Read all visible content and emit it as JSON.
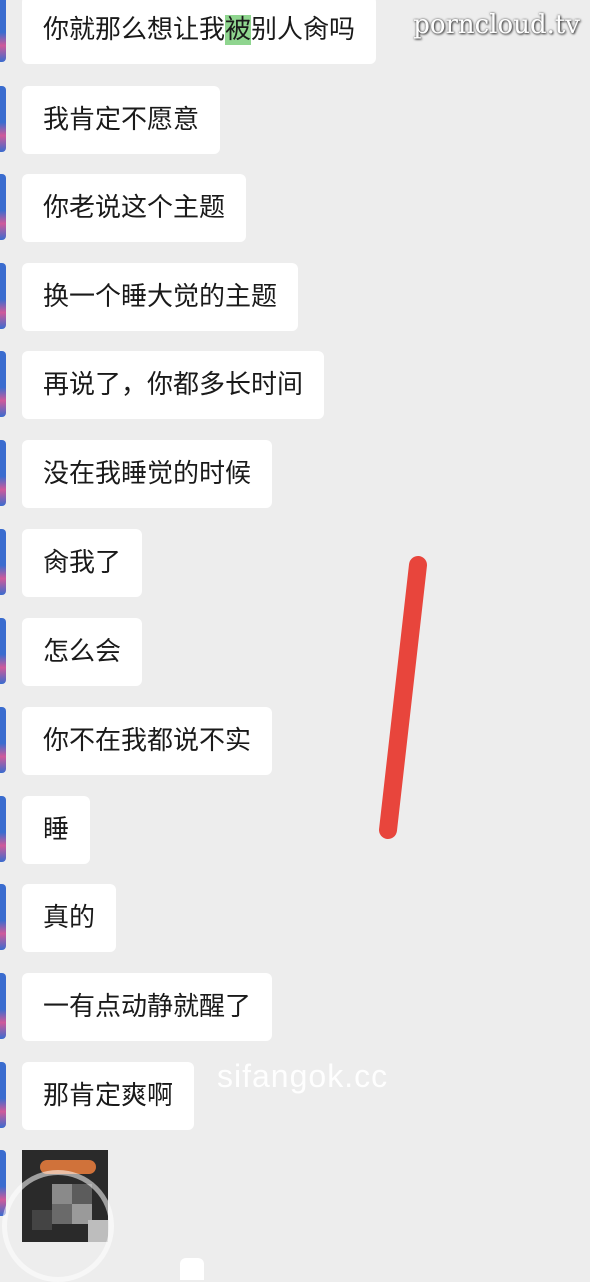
{
  "watermarks": {
    "top_right": "porncloud.tv",
    "middle": "sifangok.cc"
  },
  "messages": [
    {
      "pre": "你就那么想让我",
      "highlight": "被",
      "post": "别人肏吗"
    },
    {
      "pre": "我肯定不愿意",
      "highlight": "",
      "post": ""
    },
    {
      "pre": "你老说这个主题",
      "highlight": "",
      "post": ""
    },
    {
      "pre": "换一个睡大觉的主题",
      "highlight": "",
      "post": ""
    },
    {
      "pre": "再说了，你都多长时间",
      "highlight": "",
      "post": ""
    },
    {
      "pre": "没在我睡觉的时候",
      "highlight": "",
      "post": ""
    },
    {
      "pre": "肏我了",
      "highlight": "",
      "post": ""
    },
    {
      "pre": "怎么会",
      "highlight": "",
      "post": ""
    },
    {
      "pre": "你不在我都说不实",
      "highlight": "",
      "post": ""
    },
    {
      "pre": "睡",
      "highlight": "",
      "post": ""
    },
    {
      "pre": "真的",
      "highlight": "",
      "post": ""
    },
    {
      "pre": "一有点动静就醒了",
      "highlight": "",
      "post": ""
    },
    {
      "pre": "那肯定爽啊",
      "highlight": "",
      "post": ""
    }
  ],
  "annotation_color": "#e8453c",
  "highlight_color": "#8fd58f"
}
